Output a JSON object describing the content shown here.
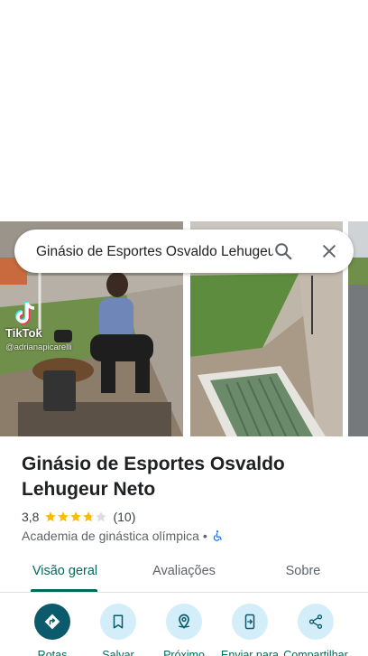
{
  "search": {
    "query": "Ginásio de Esportes Osvaldo Lehugeur Neto",
    "search_icon": "search-icon",
    "close_icon": "close-icon"
  },
  "photos": {
    "watermark_brand": "TikTok",
    "watermark_handle": "@adrianapicarelli"
  },
  "place": {
    "title": "Ginásio de Esportes Osvaldo Lehugeur Neto",
    "rating": "3,8",
    "rating_stars": 3.8,
    "reviews": "(10)",
    "category": "Academia de ginástica olímpica",
    "separator": "•",
    "accessibility_icon": "wheelchair-icon"
  },
  "tabs": [
    {
      "label": "Visão geral",
      "active": true
    },
    {
      "label": "Avaliações",
      "active": false
    },
    {
      "label": "Sobre",
      "active": false
    }
  ],
  "actions": [
    {
      "label": "Rotas",
      "icon": "directions-icon"
    },
    {
      "label": "Salvar",
      "icon": "bookmark-icon"
    },
    {
      "label": "Próximo",
      "icon": "nearby-icon"
    },
    {
      "label": "Enviar para",
      "icon": "send-to-phone-icon"
    },
    {
      "label": "Compartilhar",
      "icon": "share-icon"
    }
  ],
  "colors": {
    "accent": "#00695c",
    "primary_action": "#0b5b6c",
    "action_bg": "#d3eef8",
    "star": "#fbbc04",
    "star_empty": "#dadce0"
  }
}
